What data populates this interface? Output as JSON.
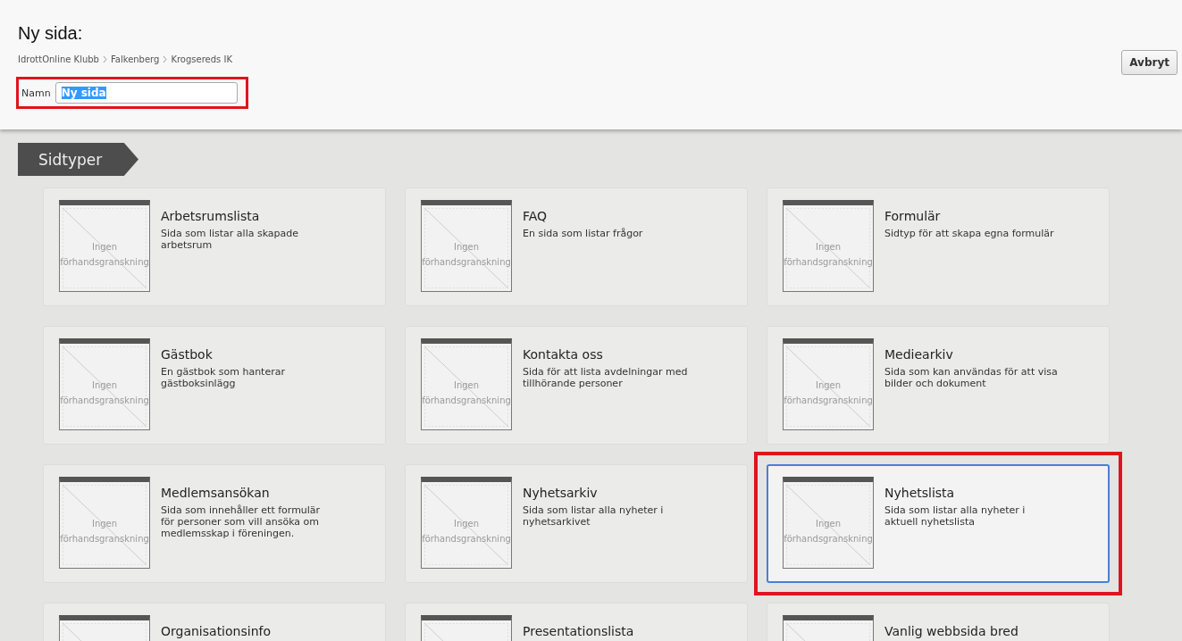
{
  "header": {
    "title": "Ny sida:",
    "breadcrumb": [
      "IdrottOnline Klubb",
      "Falkenberg",
      "Krogsereds IK"
    ],
    "name_field": {
      "label": "Namn",
      "value": "Ny sida",
      "text_selected": true,
      "highlighted": true
    },
    "cancel_button": "Avbryt"
  },
  "section_tag": "Sidtyper",
  "page_types": [
    {
      "title": "Arbetsrumslista",
      "description": "Sida som listar alla skapade arbetsrum",
      "preview": "Ingen förhandsgranskning",
      "selected": false
    },
    {
      "title": "FAQ",
      "description": "En sida som listar frågor",
      "preview": "Ingen förhandsgranskning",
      "selected": false
    },
    {
      "title": "Formulär",
      "description": "Sidtyp för att skapa egna formulär",
      "preview": "Ingen förhandsgranskning",
      "selected": false
    },
    {
      "title": "Gästbok",
      "description": "En gästbok som hanterar gästboksinlägg",
      "preview": "Ingen förhandsgranskning",
      "selected": false
    },
    {
      "title": "Kontakta oss",
      "description": "Sida för att lista avdelningar med tillhörande personer",
      "preview": "Ingen förhandsgranskning",
      "selected": false
    },
    {
      "title": "Mediearkiv",
      "description": "Sida som kan användas för att visa bilder och dokument",
      "preview": "Ingen förhandsgranskning",
      "selected": false
    },
    {
      "title": "Medlemsansökan",
      "description": "Sida som innehåller ett formulär för personer som vill ansöka om medlemsskap i föreningen.",
      "preview": "Ingen förhandsgranskning",
      "selected": false
    },
    {
      "title": "Nyhetsarkiv",
      "description": "Sida som listar alla nyheter i nyhetsarkivet",
      "preview": "Ingen förhandsgranskning",
      "selected": false
    },
    {
      "title": "Nyhetslista",
      "description": "Sida som listar alla nyheter i aktuell nyhetslista",
      "preview": "Ingen förhandsgranskning",
      "selected": true
    },
    {
      "title": "Organisationsinfo",
      "selected": false
    },
    {
      "title": "Presentationslista",
      "selected": false
    },
    {
      "title": "Vanlig webbsida bred",
      "selected": false
    }
  ]
}
